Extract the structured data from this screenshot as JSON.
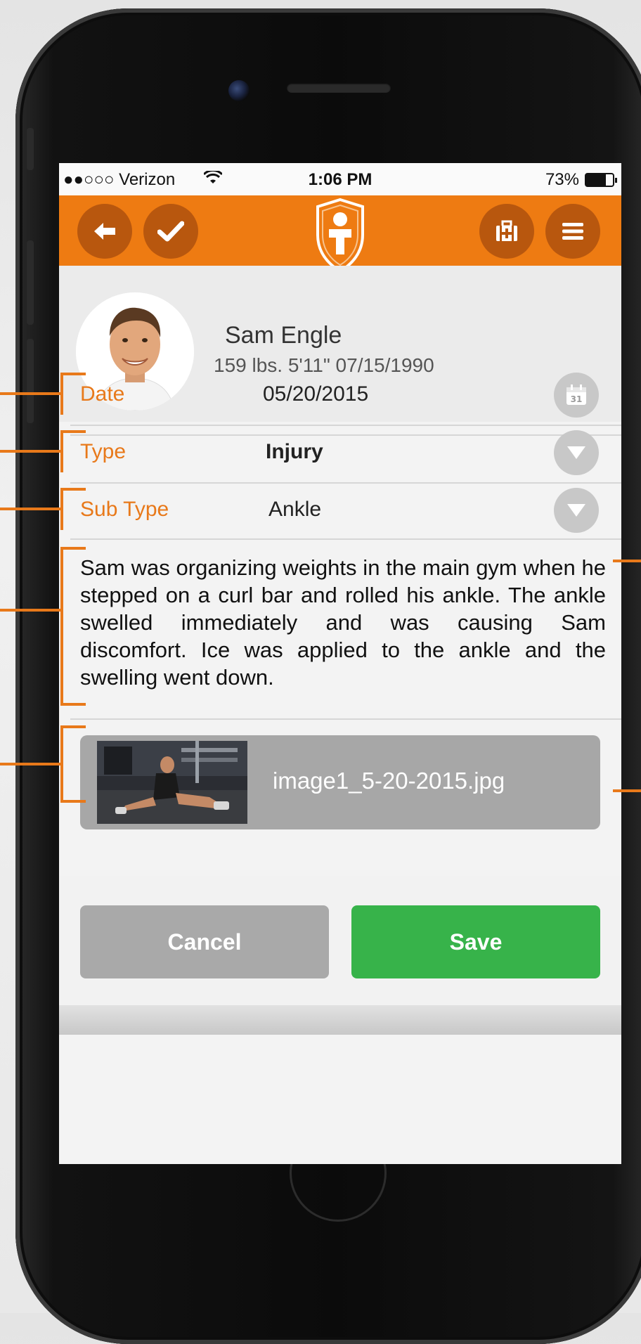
{
  "status": {
    "carrier": "●●○○○ Verizon",
    "time": "1:06 PM",
    "battery": "73%",
    "battery_level": 0.73
  },
  "navbar": {
    "back_icon": "arrow-left-icon",
    "check_icon": "checkmark-icon",
    "logo_icon": "shield-person-logo",
    "medical_icon": "first-aid-kit-icon",
    "menu_icon": "hamburger-menu-icon"
  },
  "profile": {
    "name": "Sam Engle",
    "stats": "159 lbs. 5'11\" 07/15/1990"
  },
  "form": {
    "date_label": "Date",
    "date_value": "05/20/2015",
    "type_label": "Type",
    "type_value": "Injury",
    "subtype_label": "Sub Type",
    "subtype_value": "Ankle",
    "notes": "Sam was organizing weights in the main gym when he stepped on a curl bar and rolled his ankle. The ankle swelled immediately and was causing Sam discomfort. Ice was applied  to the ankle and the swelling went down."
  },
  "attachment": {
    "filename": "image1_5-20-2015.jpg"
  },
  "footer": {
    "cancel_label": "Cancel",
    "save_label": "Save"
  },
  "colors": {
    "accent": "#ee7b12",
    "label_orange": "#e8791a",
    "save_green": "#37b34a",
    "cancel_gray": "#a9a9a9"
  }
}
